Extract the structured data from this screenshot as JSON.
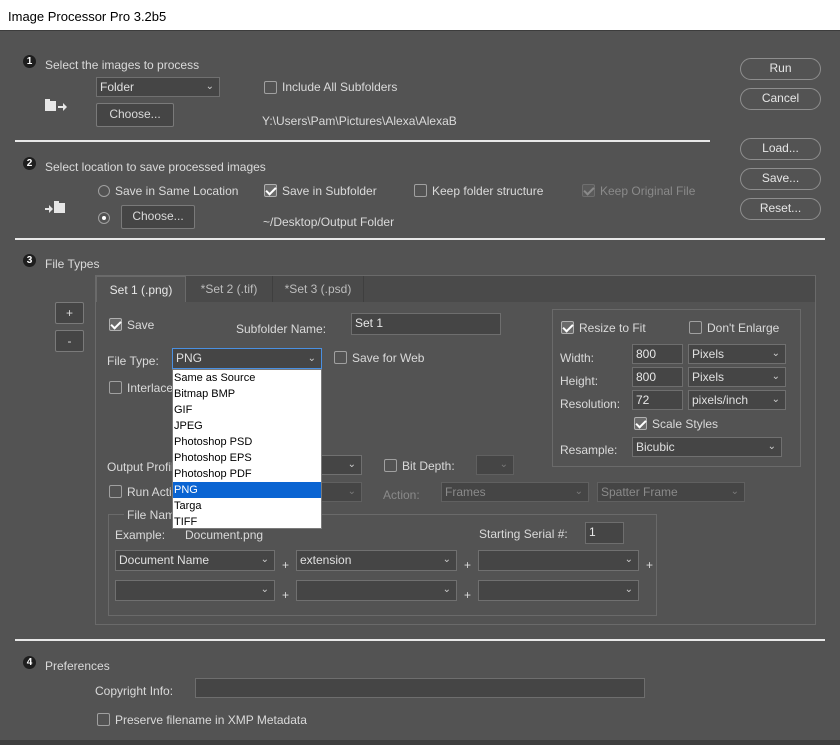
{
  "window": {
    "title": "Image Processor Pro 3.2b5"
  },
  "section1": {
    "num": "1",
    "title": "Select the images to process",
    "source_select": "Folder",
    "choose": "Choose...",
    "include_subfolders": "Include All Subfolders",
    "path": "Y:\\Users\\Pam\\Pictures\\Alexa\\AlexaB"
  },
  "section2": {
    "num": "2",
    "title": "Select location to save processed images",
    "save_same": "Save in Same Location",
    "choose": "Choose...",
    "save_subfolder": "Save in Subfolder",
    "keep_structure": "Keep folder structure",
    "keep_original": "Keep Original File",
    "path": "~/Desktop/Output Folder"
  },
  "section3": {
    "num": "3",
    "title": "File Types",
    "plus": "+",
    "minus": "-",
    "tabs": [
      "Set 1 (.png)",
      "*Set 2 (.tif)",
      "*Set 3 (.psd)"
    ],
    "save": "Save",
    "subfolder_label": "Subfolder Name:",
    "subfolder_value": "Set 1",
    "filetype_label": "File Type:",
    "filetype_value": "PNG",
    "save_for_web": "Save for Web",
    "interlace": "Interlace",
    "output_profile": "Output Profile",
    "bit_depth": "Bit Depth:",
    "run_action": "Run Action",
    "action_label": "Action:",
    "action_set": "Frames",
    "action_name": "Spatter Frame",
    "file_naming": "File Naming",
    "example_label": "Example:",
    "example_value": "Document.png",
    "serial_label": "Starting Serial #:",
    "serial_value": "1",
    "naming": [
      "Document Name",
      "extension",
      "",
      "",
      "",
      ""
    ],
    "plus_sign": "+",
    "resize": {
      "resize_to_fit": "Resize to Fit",
      "dont_enlarge": "Don't Enlarge",
      "width_label": "Width:",
      "width": "800",
      "width_unit": "Pixels",
      "height_label": "Height:",
      "height": "800",
      "height_unit": "Pixels",
      "resolution_label": "Resolution:",
      "resolution": "72",
      "resolution_unit": "pixels/inch",
      "scale_styles": "Scale Styles",
      "resample_label": "Resample:",
      "resample": "Bicubic"
    },
    "dropdown_options": [
      "Same as Source",
      "Bitmap BMP",
      "GIF",
      "JPEG",
      "Photoshop PSD",
      "Photoshop EPS",
      "Photoshop PDF",
      "PNG",
      "Targa",
      "TIFF"
    ],
    "dropdown_selected": "PNG"
  },
  "section4": {
    "num": "4",
    "title": "Preferences",
    "copyright_label": "Copyright Info:",
    "copyright_value": "",
    "preserve": "Preserve filename in XMP Metadata"
  },
  "buttons": {
    "run": "Run",
    "cancel": "Cancel",
    "load": "Load...",
    "save": "Save...",
    "reset": "Reset..."
  },
  "icons": {
    "folder": "folder-open-icon",
    "destination": "folder-save-icon",
    "chevron": "chevron-down-icon"
  }
}
